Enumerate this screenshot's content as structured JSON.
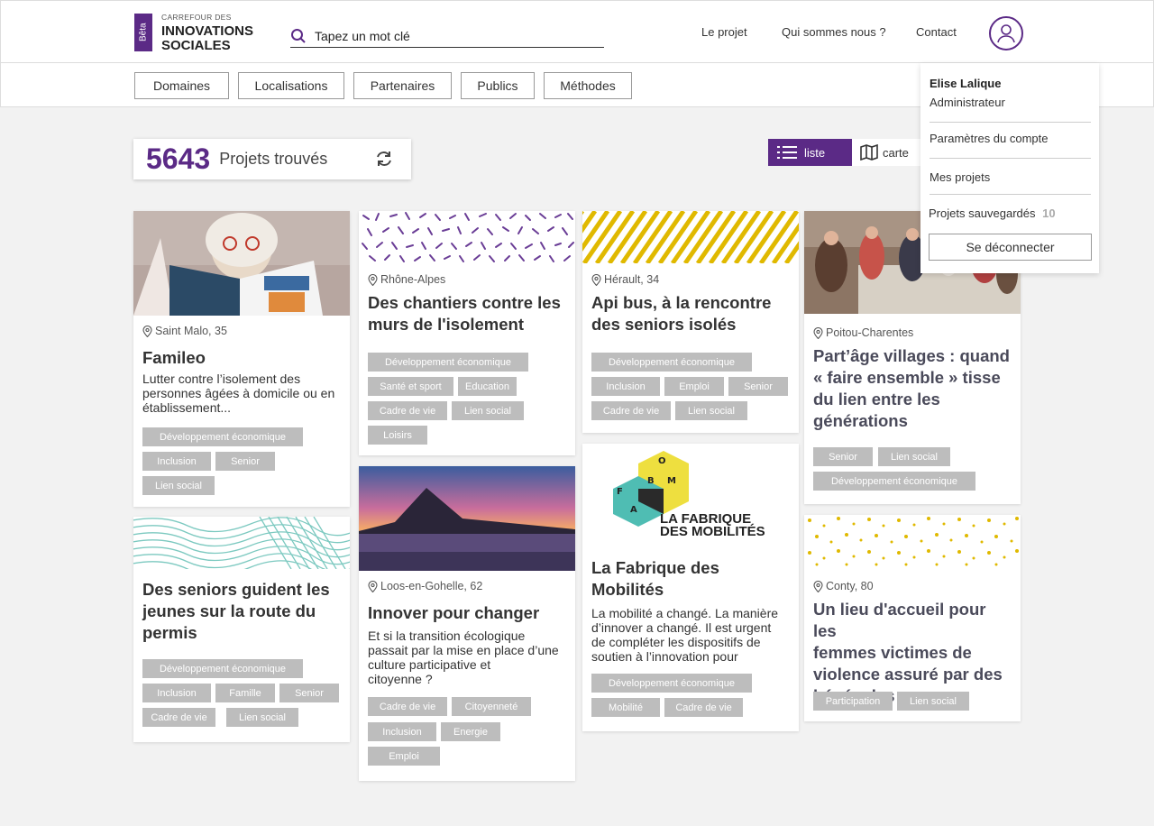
{
  "header": {
    "beta": "Bêta",
    "logo_line1": "CARREFOUR DES",
    "logo_line2": "INNOVATIONS",
    "logo_line3": "SOCIALES",
    "search_placeholder": "Tapez un mot clé",
    "nav": [
      "Le projet",
      "Qui sommes nous ?",
      "Contact"
    ]
  },
  "filters": [
    "Domaines",
    "Localisations",
    "Partenaires",
    "Publics",
    "Méthodes"
  ],
  "results": {
    "count": "5643",
    "label": "Projets trouvés"
  },
  "view": {
    "list": "liste",
    "map": "carte"
  },
  "colors": {
    "accent": "#5b2a86",
    "tag": "#bdbdbd",
    "yellow": "#e0b900",
    "teal": "#7cc9c0"
  },
  "user_menu": {
    "name": "Elise Lalique",
    "role": "Administrateur",
    "settings": "Paramètres du compte",
    "my_projects": "Mes projets",
    "saved": "Projets sauvegardés",
    "saved_count": "10",
    "logout": "Se déconnecter"
  },
  "cards": [
    {
      "location": "Saint Malo, 35",
      "title_lines": [
        "Famileo"
      ],
      "desc_lines": [
        "Lutter contre l’isolement des",
        "personnes âgées à domicile ou en",
        "établissement..."
      ],
      "tags": [
        "Développement économique",
        "Inclusion",
        "Senior",
        "Lien social"
      ]
    },
    {
      "location": "",
      "title_lines": [
        "Des seniors guident les",
        "jeunes sur la route du",
        "permis"
      ],
      "desc_lines": [],
      "tags": [
        "Développement économique",
        "Inclusion",
        "Famille",
        "Senior",
        "Cadre de vie",
        "Lien social"
      ]
    },
    {
      "location": "Rhône-Alpes",
      "title_lines": [
        "Des chantiers contre les",
        "murs de l'isolement"
      ],
      "desc_lines": [],
      "tags": [
        "Développement économique",
        "Santé et sport",
        "Education",
        "Cadre de vie",
        "Lien social",
        "Loisirs"
      ]
    },
    {
      "location": "Loos-en-Gohelle, 62",
      "title_lines": [
        "Innover pour changer"
      ],
      "desc_lines": [
        " Et si la transition écologique",
        "passait par la mise en place d’une",
        "culture participative et",
        "citoyenne ?"
      ],
      "tags": [
        "Cadre de vie",
        "Citoyenneté",
        "Inclusion",
        "Energie",
        "Emploi"
      ]
    },
    {
      "location": "Hérault, 34",
      "title_lines": [
        "Api bus, à la rencontre",
        "des seniors isolés"
      ],
      "desc_lines": [],
      "tags": [
        "Développement économique",
        "Inclusion",
        "Emploi",
        "Senior",
        "Cadre de vie",
        "Lien social"
      ]
    },
    {
      "location": "",
      "title_lines": [
        "La Fabrique des",
        "Mobilités"
      ],
      "desc_lines": [
        "La mobilité a changé. La manière",
        "d’innover a changé. Il est urgent",
        "de compléter les dispositifs de",
        "soutien à l’innovation pour"
      ],
      "tags": [
        "Développement économique",
        "Mobilité",
        "Cadre de vie"
      ],
      "logo_text": [
        "LA FABRIQUE",
        "DES MOBILITÉS"
      ],
      "logo_letters": [
        "O",
        "M",
        "B",
        "F",
        "A"
      ]
    },
    {
      "location": "Poitou-Charentes",
      "title_lines": [
        "Part’âge villages : quand",
        "«  faire ensemble » tisse",
        "du lien entre les",
        "générations"
      ],
      "desc_lines": [],
      "tags": [
        "Senior",
        "Lien social",
        "Développement économique"
      ]
    },
    {
      "location": "Conty, 80",
      "title_lines": [
        "Un lieu d'accueil pour les",
        "femmes victimes de",
        "violence assuré par des",
        "bénévoles"
      ],
      "desc_lines": [],
      "tags": [
        "Participation",
        "Lien social"
      ]
    }
  ]
}
